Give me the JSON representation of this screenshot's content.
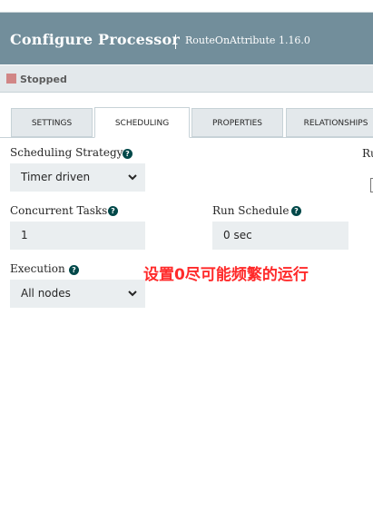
{
  "dialog": {
    "title": "Configure Processor",
    "subtitle": "RouteOnAttribute 1.16.0"
  },
  "status": {
    "text": "Stopped",
    "color": "#d18686"
  },
  "tabs": [
    {
      "label": "SETTINGS",
      "active": false
    },
    {
      "label": "SCHEDULING",
      "active": true
    },
    {
      "label": "PROPERTIES",
      "active": false
    },
    {
      "label": "RELATIONSHIPS",
      "active": false
    }
  ],
  "scheduling": {
    "strategy_label": "Scheduling Strategy",
    "strategy_value": "Timer driven",
    "concurrent_label": "Concurrent Tasks",
    "concurrent_value": "1",
    "run_schedule_label": "Run Schedule",
    "run_schedule_value": "0 sec",
    "execution_label": "Execution",
    "execution_value": "All nodes",
    "cut_label": "Ru"
  },
  "annotation": {
    "text": "设置0尽可能频繁的运行",
    "color": "#ff2a2a"
  },
  "icons": {
    "help": "help-icon",
    "dropdown": "chevron-down-icon"
  },
  "colors": {
    "header": "#728e9b",
    "help_icon": "#004849",
    "field_bg": "#eaeef0"
  }
}
